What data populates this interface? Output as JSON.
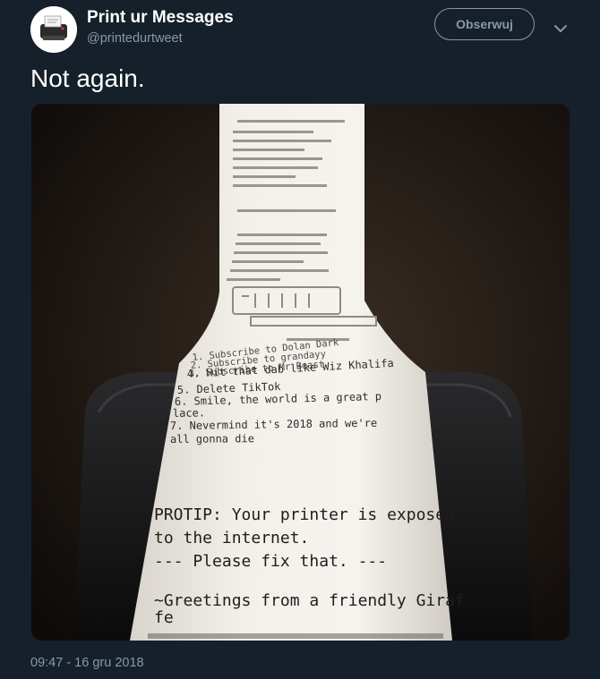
{
  "author": {
    "display_name": "Print ur Messages",
    "handle": "@printedurtweet",
    "avatar_icon": "printer-icon"
  },
  "actions": {
    "follow_label": "Obserwuj",
    "more_icon": "chevron-down-icon"
  },
  "tweet": {
    "text": "Not again.",
    "timestamp": "09:47 - 16 gru 2018"
  },
  "receipt": {
    "lines": [
      "1. Subscribe to Dolan Dark",
      "2. Subscribe to grandayy",
      "3. Subscribe to Mr Beast",
      "4. Hit that dab like Wiz Khalifa",
      "5. Delete TikTok",
      "6. Smile, the world is a great p",
      "lace.",
      "7. Nevermind it's 2018 and we're",
      "all gonna die"
    ],
    "protip": [
      "PROTIP: Your printer is exposed",
      "to the internet.",
      "--- Please fix that. ---"
    ],
    "greeting": [
      "~Greetings from a friendly Giraf",
      "fe"
    ]
  },
  "colors": {
    "background": "#15202b",
    "secondary_text": "#8899a6"
  }
}
